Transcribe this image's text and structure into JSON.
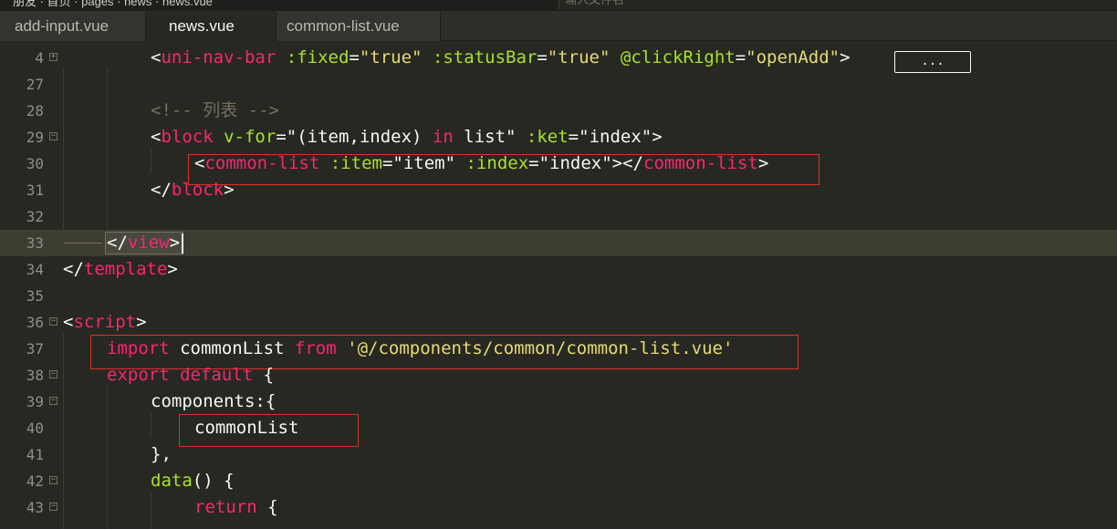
{
  "top_strip": {
    "breadcrumb": "朋友 · 首页 · pages · news · news.vue",
    "search_placeholder": "输入文件名"
  },
  "tabs": [
    {
      "label": "add-input.vue",
      "active": false
    },
    {
      "label": "news.vue",
      "active": true
    },
    {
      "label": "common-list.vue",
      "active": false
    }
  ],
  "lines": [
    {
      "num": "4",
      "fold": "plus"
    },
    {
      "num": "27",
      "fold": ""
    },
    {
      "num": "28",
      "fold": ""
    },
    {
      "num": "29",
      "fold": "minus"
    },
    {
      "num": "30",
      "fold": ""
    },
    {
      "num": "31",
      "fold": ""
    },
    {
      "num": "32",
      "fold": ""
    },
    {
      "num": "33",
      "fold": ""
    },
    {
      "num": "34",
      "fold": ""
    },
    {
      "num": "35",
      "fold": ""
    },
    {
      "num": "36",
      "fold": "minus"
    },
    {
      "num": "37",
      "fold": ""
    },
    {
      "num": "38",
      "fold": "minus"
    },
    {
      "num": "39",
      "fold": "minus"
    },
    {
      "num": "40",
      "fold": ""
    },
    {
      "num": "41",
      "fold": ""
    },
    {
      "num": "42",
      "fold": "minus"
    },
    {
      "num": "43",
      "fold": "minus"
    }
  ],
  "tokens": {
    "l4": [
      "<",
      "uni-nav-bar",
      " ",
      ":fixed",
      "=",
      "\"true\"",
      " ",
      ":statusBar",
      "=",
      "\"true\"",
      " ",
      "@clickRight",
      "=",
      "\"openAdd\"",
      ">"
    ],
    "l4_ellipsis": "...",
    "l28": "<!-- 列表 -->",
    "l29": [
      "<",
      "block",
      " ",
      "v-for",
      "=",
      "\"(item,index) ",
      "in",
      " list\"",
      " ",
      ":ket",
      "=",
      "\"index\"",
      ">"
    ],
    "l30": [
      "<",
      "common-list",
      " ",
      ":item",
      "=",
      "\"item\"",
      " ",
      ":index",
      "=",
      "\"index\"",
      "></",
      "common-list",
      ">"
    ],
    "l31": [
      "</",
      "block",
      ">"
    ],
    "l33": [
      "</",
      "view",
      ">"
    ],
    "l34": [
      "</",
      "template",
      ">"
    ],
    "l36": [
      "<",
      "script",
      ">"
    ],
    "l37": [
      "import",
      " commonList ",
      "from",
      " ",
      "'@/components/common/common-list.vue'"
    ],
    "l38": [
      "export",
      " ",
      "default",
      " {"
    ],
    "l39": [
      "components",
      ":{"
    ],
    "l40": "commonList",
    "l41": "},",
    "l42": [
      "data",
      "() {"
    ],
    "l43": [
      "return",
      " {"
    ]
  }
}
